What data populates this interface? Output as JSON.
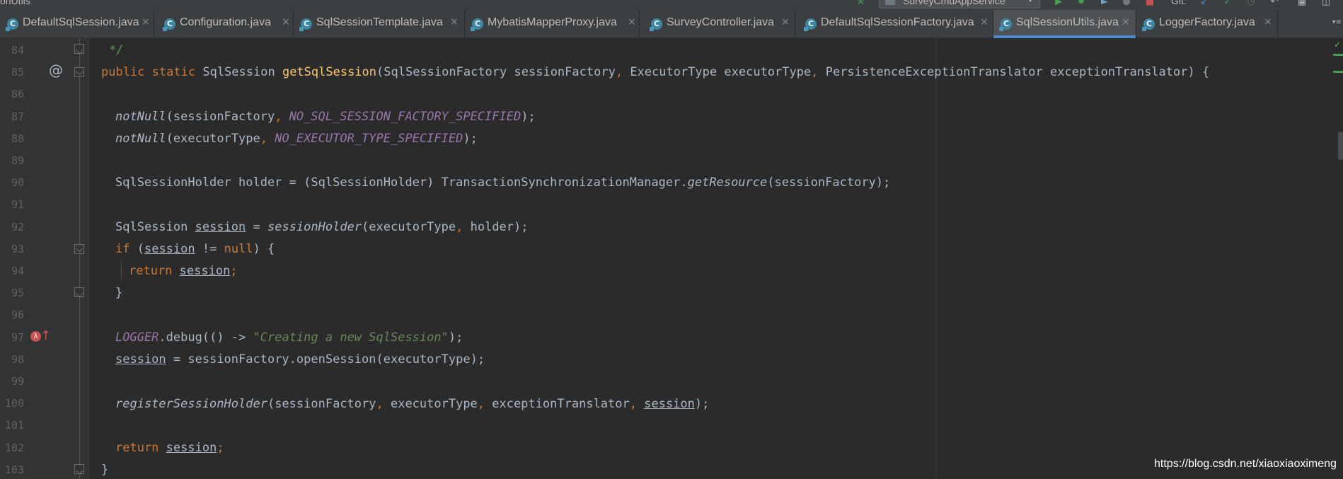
{
  "window": {
    "title_fragment": "onUtils"
  },
  "toolbar": {
    "run_config": "SurveyCmdAppService",
    "vcs_label": "Git:",
    "icons": [
      "build-hammer-icon",
      "run-icon",
      "debug-icon",
      "run-with-coverage-icon",
      "profile-icon",
      "stop-icon",
      "vcs-update-icon",
      "vcs-commit-icon",
      "vcs-history-icon",
      "vcs-revert-icon",
      "project-structure-icon",
      "layout-icon"
    ]
  },
  "tabs": [
    {
      "label": "DefaultSqlSession.java",
      "active": false
    },
    {
      "label": "Configuration.java",
      "active": false
    },
    {
      "label": "SqlSessionTemplate.java",
      "active": false
    },
    {
      "label": "MybatisMapperProxy.java",
      "active": false
    },
    {
      "label": "SurveyController.java",
      "active": false
    },
    {
      "label": "DefaultSqlSessionFactory.java",
      "active": false
    },
    {
      "label": "SqlSessionUtils.java",
      "active": true
    },
    {
      "label": "LoggerFactory.java",
      "active": false
    }
  ],
  "tab_overflow": "▾≡",
  "tab_close_glyph": "×",
  "class_icon_glyph": "C",
  "gutter": {
    "at_glyph": "@",
    "lambda_glyph": "λ",
    "lambda_arrow": "↑",
    "check_glyph": "✓"
  },
  "line_numbers": [
    "84",
    "85",
    "86",
    "87",
    "88",
    "89",
    "90",
    "91",
    "92",
    "93",
    "94",
    "95",
    "96",
    "97",
    "98",
    "99",
    "100",
    "101",
    "102",
    "103"
  ],
  "code": {
    "l84": {
      "cmt": "*/"
    },
    "l85": {
      "kw1": "public",
      "kw2": "static",
      "ret": "SqlSession",
      "fn": "getSqlSession",
      "p1t": "SqlSessionFactory",
      "p1": "sessionFactory",
      "comma": ",",
      "p2t": "ExecutorType",
      "p2": "executorType",
      "p3t": "PersistenceExceptionTranslator",
      "p3": "exceptionTranslator",
      "open": ") {"
    },
    "l87": {
      "call": "notNull",
      "arg": "sessionFactory",
      "cst": "NO_SQL_SESSION_FACTORY_SPECIFIED",
      "end": ");"
    },
    "l88": {
      "call": "notNull",
      "arg": "executorType",
      "cst": "NO_EXECUTOR_TYPE_SPECIFIED",
      "end": ");"
    },
    "l90": {
      "type": "SqlSessionHolder",
      "var": "holder",
      "cast": "(SqlSessionHolder)",
      "cls": "TransactionSynchronizationManager",
      "call": "getResource",
      "arg": "sessionFactory",
      "end": ");"
    },
    "l92": {
      "type": "SqlSession",
      "var": "session",
      "call": "sessionHolder",
      "arg1": "executorType",
      "arg2": "holder",
      "end": ");"
    },
    "l93": {
      "kw": "if",
      "var": "session",
      "op": "!=",
      "nul": "null",
      "brace": ") {"
    },
    "l94": {
      "kw": "return",
      "var": "session",
      "end": ";"
    },
    "l95": {
      "brace": "}"
    },
    "l97": {
      "cst": "LOGGER",
      "call": "debug",
      "lambda": "(() -> ",
      "str": "\"Creating a new SqlSession\"",
      "end": ");"
    },
    "l98": {
      "var": "session",
      "recv": "sessionFactory",
      "call": "openSession",
      "arg": "executorType",
      "end": ");"
    },
    "l100": {
      "call": "registerSessionHolder",
      "a1": "sessionFactory",
      "a2": "executorType",
      "a3": "exceptionTranslator",
      "a4": "session",
      "end": ");"
    },
    "l102": {
      "kw": "return",
      "var": "session",
      "end": ";"
    },
    "l103": {
      "brace": "}"
    }
  },
  "colors": {
    "background": "#2b2b2b",
    "gutter": "#313335",
    "keyword": "#cc7832",
    "method": "#ffc66d",
    "constant": "#9876aa",
    "string": "#6a8759",
    "text": "#a9b7c6",
    "active_tab_underline": "#4a88c7"
  },
  "watermark": "https://blog.csdn.net/xiaoxiaoximeng"
}
